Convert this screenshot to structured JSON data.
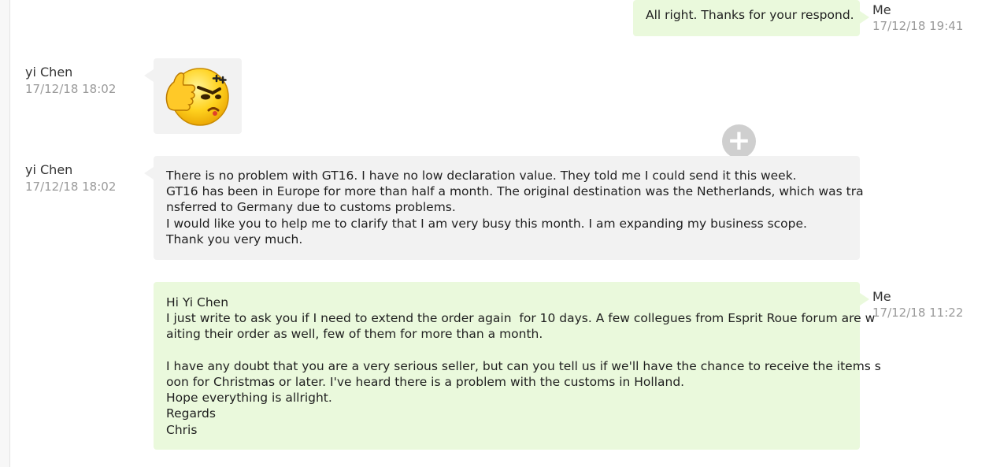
{
  "messages": [
    {
      "sender": "Me",
      "time": "17/12/18 19:41",
      "lines": [
        "All right. Thanks for your respond."
      ]
    },
    {
      "sender": "yi Chen",
      "time": "17/12/18 18:02",
      "sticker": "thumbs-up-emoji"
    },
    {
      "sender": "yi Chen",
      "time": "17/12/18 18:02",
      "lines": [
        "There is no problem with GT16. I have no low declaration value. They told me I could send it this week.",
        "GT16 has been in Europe for more than half a month. The original destination was the Netherlands, which was tra",
        "nsferred to Germany due to customs problems.",
        "I would like you to help me to clarify that I am very busy this month. I am expanding my business scope.",
        "Thank you very much."
      ]
    },
    {
      "sender": "Me",
      "time": "17/12/18 11:22",
      "lines": [
        "Hi Yi Chen",
        "I just write to ask you if I need to extend the order again  for 10 days. A few collegues from Esprit Roue forum are w",
        "aiting their order as well, few of them for more than a month.",
        "",
        "I have any doubt that you are a very serious seller, but can you tell us if we'll have the chance to receive the items s",
        "oon for Christmas or later. I've heard there is a problem with the customs in Holland.",
        "Hope everything is allright.",
        "Regards",
        "Chris"
      ]
    }
  ],
  "controls": {
    "add_icon": "plus-icon",
    "add_glyph": "+"
  },
  "colors": {
    "incoming_bubble": "#f2f2f2",
    "outgoing_bubble": "#eaf9dc"
  }
}
